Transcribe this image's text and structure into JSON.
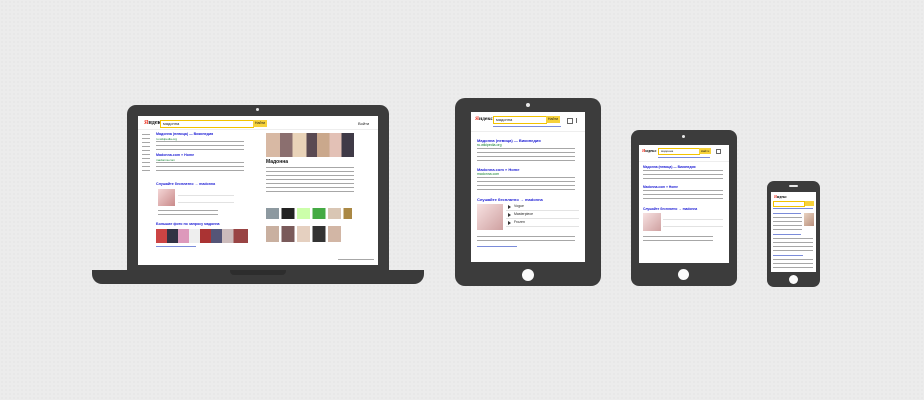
{
  "brand": {
    "logo_prefix": "Я",
    "logo_rest": "ндекс"
  },
  "search": {
    "query": "мадонна",
    "button_label": "Найти"
  },
  "user": {
    "login_label": "Войти"
  },
  "serp": {
    "result1_title": "Мадонна (певица) — Википедия",
    "result1_url": "ru.wikipedia.org",
    "result2_title": "Madonna.com » Home",
    "result2_url": "madonna.com",
    "music_title": "Слушайте бесплатно → madonna",
    "images_title": "Большие фото по запросу мадонна"
  },
  "tracks": [
    {
      "title": "Vogue"
    },
    {
      "title": "Masterpiece"
    },
    {
      "title": "Frozen"
    }
  ],
  "knowledge": {
    "title": "Мадонна"
  },
  "colors": {
    "device": "#3c3c3c",
    "accent_yellow": "#f7d23a",
    "link": "#1a1ad4",
    "url_green": "#0a7a2a"
  }
}
